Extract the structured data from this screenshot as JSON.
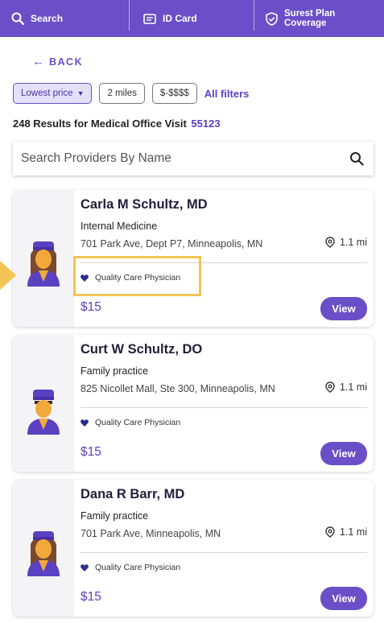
{
  "nav": {
    "search": "Search",
    "id_card": "ID Card",
    "coverage_line1": "Surest Plan",
    "coverage_line2": "Coverage"
  },
  "back": {
    "arrow": "←",
    "label": "BACK"
  },
  "filters": {
    "sort": "Lowest price",
    "distance": "2 miles",
    "cost": "$-$$$$",
    "all": "All filters"
  },
  "results": {
    "text": "248 Results for Medical Office Visit",
    "zip": "55123"
  },
  "search": {
    "placeholder": "Search Providers By Name"
  },
  "providers": [
    {
      "name": "Carla M Schultz, MD",
      "specialty": "Internal Medicine",
      "address": "701 Park Ave, Dept P7, Minneapolis, MN",
      "distance": "1.1 mi",
      "badge": "Quality Care Physician",
      "price": "$15",
      "action": "View",
      "avatar": "female-doctor-avatar"
    },
    {
      "name": "Curt W Schultz, DO",
      "specialty": "Family practice",
      "address": "825 Nicollet Mall, Ste 300, Minneapolis, MN",
      "distance": "1.1 mi",
      "badge": "Quality Care Physician",
      "price": "$15",
      "action": "View",
      "avatar": "male-doctor-avatar"
    },
    {
      "name": "Dana R Barr, MD",
      "specialty": "Family practice",
      "address": "701 Park Ave, Minneapolis, MN",
      "distance": "1.1 mi",
      "badge": "Quality Care Physician",
      "price": "$15",
      "action": "View",
      "avatar": "female-doctor-avatar"
    }
  ],
  "colors": {
    "brand": "#6a4fc8",
    "highlight": "#f3c456",
    "heart": "#2a2f8f"
  }
}
